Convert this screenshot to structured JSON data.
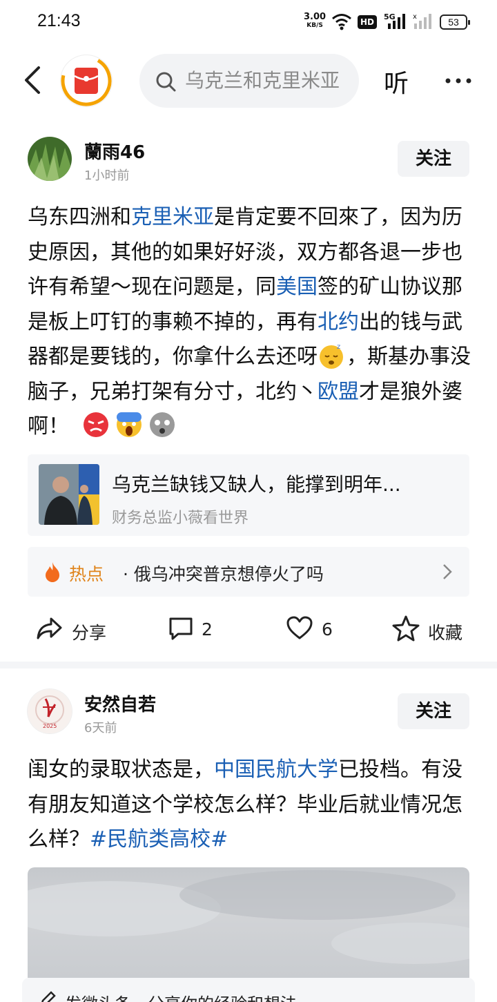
{
  "status_bar": {
    "time": "21:43",
    "net_speed": "3.00",
    "net_unit": "KB/S",
    "hd_badge": "HD",
    "net_type": "5G",
    "battery": "53"
  },
  "top_bar": {
    "search_query": "乌克兰和克里米亚",
    "listen_label": "听"
  },
  "posts": [
    {
      "author": "蘭雨46",
      "time": "1小时前",
      "follow_label": "关注",
      "content": {
        "t1": "乌东四洲和",
        "l1": "克里米亚",
        "t2": "是肯定要不回來了，因为历史原因，其他的如果好好淡，双方都各退一步也许有希望～现在问题是，同",
        "l2": "美国",
        "t3": "签的矿山协议那是板上叮钉的事赖不掉的，再有",
        "l3": "北约",
        "t4": "出的钱与武器都是要钱的，你拿什么去还呀",
        "t5": "，斯基办事没脑子，兄弟打架有分寸，北约丶",
        "l4": "欧盟",
        "t6": "才是狼外婆啊！"
      },
      "ref_card": {
        "title": "乌克兰缺钱又缺人，能撑到明年...",
        "source": "财务总监小薇看世界"
      },
      "hot": {
        "label": "热点",
        "text": "· 俄乌冲突普京想停火了吗"
      },
      "actions": {
        "share": "分享",
        "comments": "2",
        "likes": "6",
        "favorite": "收藏"
      }
    },
    {
      "author": "安然自若",
      "time": "6天前",
      "follow_label": "关注",
      "content": {
        "t1": "闺女的录取状态是，",
        "l1": "中国民航大学",
        "t2": "已投档。有没有朋友知道这个学校怎么样？毕业后就业情况怎么样？",
        "l2": "#民航类高校#"
      }
    }
  ],
  "bottom_bar": {
    "text": "发微头条，分享你的经验和想法"
  },
  "colors": {
    "link": "#1a5fb4",
    "hot": "#e0841b",
    "logo_red": "#e8392f",
    "logo_ring": "#f5a300"
  }
}
